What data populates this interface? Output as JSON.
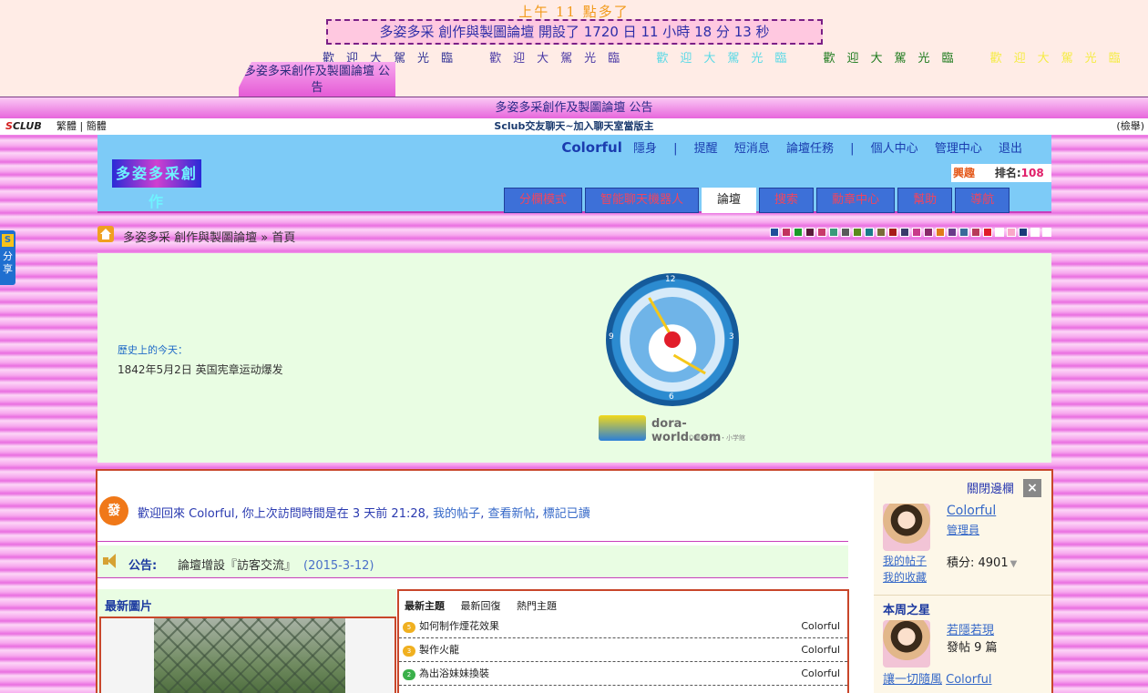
{
  "top": {
    "time": "上午 11 點多了",
    "uptime": "多姿多采 創作與製圖論壇 開設了 1720 日 11 小時 18 分 13 秒",
    "welcome": [
      "歡迎大駕光臨",
      "歡迎大駕光臨",
      "歡迎大駕光臨",
      "歡迎大駕光臨",
      "歡迎大駕光臨"
    ],
    "notice_tab": "多姿多采創作及製圖論壇 公告"
  },
  "announce_bar": "多姿多采創作及製圖論壇 公告",
  "sclub": {
    "logo_red": "S",
    "logo_rest": "CLUB",
    "lang": "繁體 | 簡體",
    "center": "Sclub交友聊天~加入聊天室當版主",
    "report": "(檢舉)"
  },
  "header": {
    "logo_text": "多姿多采創作",
    "username": "Colorful",
    "links": {
      "invisible": "隱身",
      "sep1": "|",
      "remind": "提醒",
      "sms": "短消息",
      "tasks": "論壇任務",
      "sep2": "|",
      "profile": "個人中心",
      "admin": "管理中心",
      "logout": "退出"
    },
    "rank": {
      "interest": "興趣",
      "rank_label": "排名:",
      "rank_value": "108"
    },
    "nav": [
      "分欄模式",
      "智能聊天機器人",
      "論壇",
      "搜索",
      "勳章中心",
      "幫助",
      "導航"
    ],
    "nav_active_index": 2
  },
  "breadcrumb": "多姿多采 創作與製圖論壇 » 首頁",
  "swatches": [
    "#1f4f9a",
    "#c2335f",
    "#1a9a2a",
    "#5a1a3a",
    "#c83a6a",
    "#3a9a7a",
    "#5a5a5a",
    "#5a8a1a",
    "#1a7a8a",
    "#7a6a3a",
    "#a81a1a",
    "#3a3a6a",
    "#c83a8a",
    "#8a2a6a",
    "#e07a1a",
    "#6a3a8a",
    "#3a6a9a",
    "#b83a5a",
    "#e01a2a",
    "#ffffff",
    "#f9a8c8",
    "#1a3a7a",
    "#ffffff",
    "#ffffff"
  ],
  "history": {
    "label": "歷史上的今天：",
    "text": "1842年5月2日 英国宪章运动爆发"
  },
  "clock": {
    "num12": "12",
    "num3": "3",
    "num6": "6",
    "num9": "9",
    "brand": "dora-world.com",
    "copyright": "©藤子プロ・小学館"
  },
  "welcome_panel": {
    "icon_text": "發",
    "message": "歡迎回來 Colorful, 你上次訪問時間是在 3 天前 21:28,",
    "my_posts": "我的帖子",
    "new_posts": "查看新帖",
    "mark_read": "標記已讀"
  },
  "notice": {
    "label": "公告:",
    "text": "論壇增設『訪客交流』",
    "date": "(2015-3-12)"
  },
  "pics": {
    "title": "最新圖片"
  },
  "threads": {
    "tabs": [
      "最新主題",
      "最新回復",
      "熱門主題"
    ],
    "rows": [
      {
        "icon": "5",
        "icon_color": "#f0b020",
        "title": "如何制作煙花效果",
        "author": "Colorful"
      },
      {
        "icon": "3",
        "icon_color": "#f0b020",
        "title": "製作火龍",
        "author": "Colorful"
      },
      {
        "icon": "2",
        "icon_color": "#3ab04a",
        "title": "為出浴妹妹換裝",
        "author": "Colorful"
      }
    ]
  },
  "sidebar": {
    "close": "關閉邊欄",
    "close_x": "×",
    "user_name": "Colorful",
    "user_role": "管理員",
    "my_posts": "我的帖子",
    "my_favs": "我的收藏",
    "points": "積分: 4901",
    "star_title": "本周之星",
    "star_name": "若隱若現",
    "star_posts": "發帖 9 篇",
    "star_quote": "讓一切隨風",
    "star_quote_user": "Colorful"
  },
  "share": {
    "s": "S",
    "text": "分享"
  }
}
